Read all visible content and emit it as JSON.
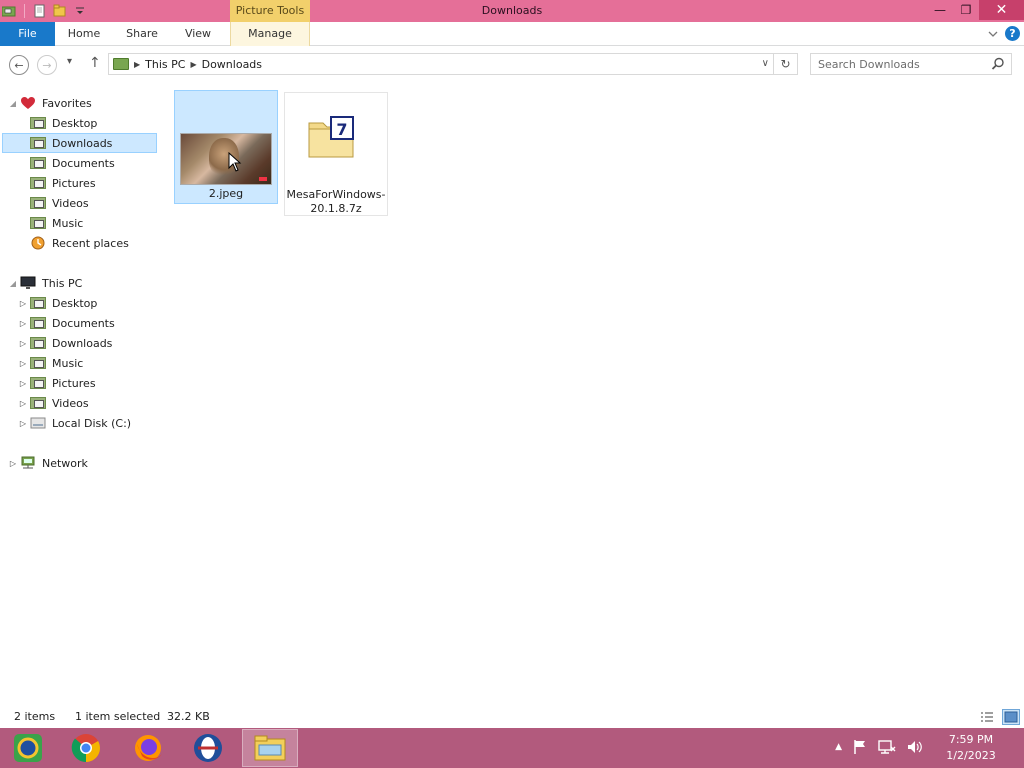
{
  "window": {
    "title": "Downloads",
    "contextual_tab_group": "Picture Tools",
    "controls": {
      "minimize": "—",
      "maximize": "❐",
      "close": "✕"
    }
  },
  "ribbon": {
    "tabs": [
      {
        "label": "File"
      },
      {
        "label": "Home"
      },
      {
        "label": "Share"
      },
      {
        "label": "View"
      },
      {
        "label": "Manage"
      }
    ]
  },
  "navigation": {
    "back": "←",
    "forward": "→",
    "recent": "▾",
    "up": "↑",
    "breadcrumb": [
      "This PC",
      "Downloads"
    ],
    "dropdown": "∨",
    "refresh": "↻",
    "search_placeholder": "Search Downloads"
  },
  "sidebar": {
    "favorites": {
      "label": "Favorites",
      "items": [
        "Desktop",
        "Downloads",
        "Documents",
        "Pictures",
        "Videos",
        "Music",
        "Recent places"
      ]
    },
    "this_pc": {
      "label": "This PC",
      "items": [
        "Desktop",
        "Documents",
        "Downloads",
        "Music",
        "Pictures",
        "Videos",
        "Local Disk (C:)"
      ]
    },
    "network": {
      "label": "Network"
    }
  },
  "files": [
    {
      "name": "2.jpeg",
      "type": "image"
    },
    {
      "name": "MesaForWindows-20.1.8.7z",
      "type": "7z-archive"
    }
  ],
  "status": {
    "item_count": "2 items",
    "selection": "1 item selected",
    "size": "32.2 KB"
  },
  "taskbar": {
    "apps": [
      "app-icon",
      "chrome-icon",
      "firefox-icon",
      "opera-icon",
      "file-explorer-icon"
    ],
    "time": "7:59 PM",
    "date": "1/2/2023"
  },
  "colors": {
    "titlebar": "#e56f98",
    "accent": "#1979ca",
    "picture_tools": "#f2d06b",
    "taskbar": "#b25a7d",
    "selection": "#cce8ff"
  }
}
